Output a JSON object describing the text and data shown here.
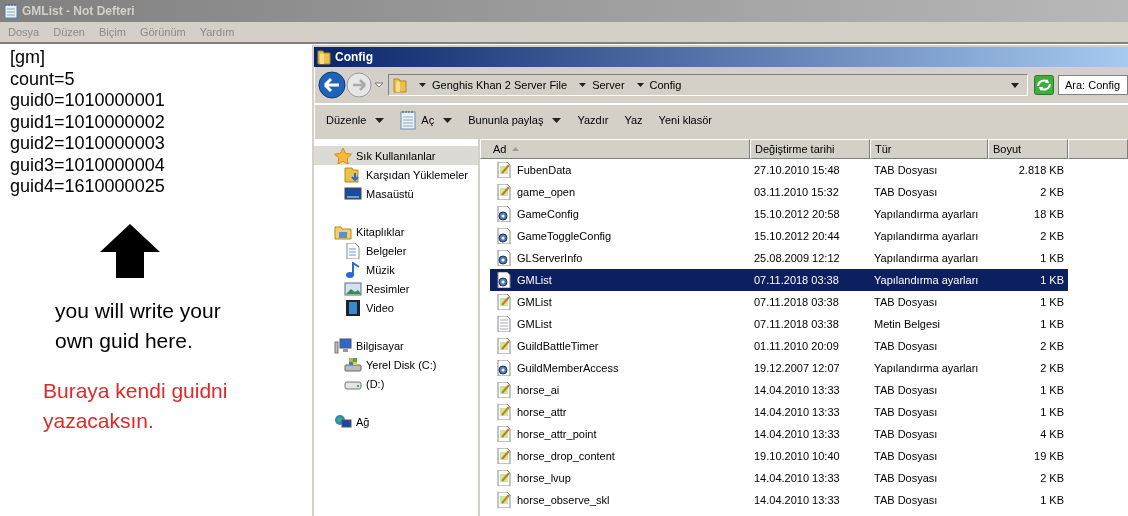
{
  "notepad": {
    "title": "GMList - Not Defteri",
    "menu": [
      "Dosya",
      "Düzen",
      "Biçim",
      "Görünüm",
      "Yardım"
    ],
    "lines": [
      "[gm]",
      "count=5",
      "guid0=1010000001",
      "guid1=1010000002",
      "guid2=1010000003",
      "guid3=1010000004",
      "guid4=1610000025"
    ],
    "note": "you will write your own guid here.",
    "note_tr": "Buraya kendi guidni yazacaksın."
  },
  "explorer": {
    "title": "Config",
    "breadcrumb": [
      "Genghis Khan 2 Server File",
      "Server",
      "Config"
    ],
    "search": {
      "placeholder": "Ara: Config"
    },
    "toolbar": [
      {
        "label": "Düzenle",
        "dropdown": true,
        "icon": false
      },
      {
        "label": "Aç",
        "dropdown": true,
        "icon": true
      },
      {
        "label": "Bununla paylaş",
        "dropdown": true,
        "icon": false
      },
      {
        "label": "Yazdır",
        "dropdown": false,
        "icon": false
      },
      {
        "label": "Yaz",
        "dropdown": false,
        "icon": false
      },
      {
        "label": "Yeni klasör",
        "dropdown": false,
        "icon": false
      }
    ],
    "nav": [
      {
        "label": "Sık Kullanılanlar",
        "kind": "star",
        "selected": true,
        "children": [
          {
            "label": "Karşıdan Yüklemeler",
            "kind": "download",
            "selected": false
          },
          {
            "label": "Masaüstü",
            "kind": "desktop",
            "selected": false
          }
        ]
      },
      {
        "label": "Kitaplıklar",
        "kind": "library",
        "selected": false,
        "children": [
          {
            "label": "Belgeler",
            "kind": "document",
            "selected": false
          },
          {
            "label": "Müzik",
            "kind": "music",
            "selected": false
          },
          {
            "label": "Resimler",
            "kind": "pictures",
            "selected": false
          },
          {
            "label": "Video",
            "kind": "video",
            "selected": false
          }
        ]
      },
      {
        "label": "Bilgisayar",
        "kind": "computer",
        "selected": false,
        "children": [
          {
            "label": "Yerel Disk (C:)",
            "kind": "disk",
            "selected": false
          },
          {
            "label": "(D:)",
            "kind": "drive",
            "selected": false
          }
        ]
      },
      {
        "label": "Ağ",
        "kind": "network",
        "selected": false
      }
    ],
    "columns": [
      {
        "label": "Ad",
        "sorted": true
      },
      {
        "label": "Değiştirme tarihi",
        "sorted": false
      },
      {
        "label": "Tür",
        "sorted": false
      },
      {
        "label": "Boyut",
        "sorted": false
      }
    ],
    "rows": [
      {
        "name": "FubenData",
        "date": "27.10.2010 15:48",
        "type": "TAB Dosyası",
        "size": "2.818 KB",
        "kind": "tab",
        "selected": false
      },
      {
        "name": "game_open",
        "date": "03.11.2010 15:32",
        "type": "TAB Dosyası",
        "size": "2 KB",
        "kind": "tab",
        "selected": false
      },
      {
        "name": "GameConfig",
        "date": "15.10.2012 20:58",
        "type": "Yapılandırma ayarları",
        "size": "18 KB",
        "kind": "config",
        "selected": false
      },
      {
        "name": "GameToggleConfig",
        "date": "15.10.2012 20:44",
        "type": "Yapılandırma ayarları",
        "size": "2 KB",
        "kind": "config",
        "selected": false
      },
      {
        "name": "GLServerInfo",
        "date": "25.08.2009 12:12",
        "type": "Yapılandırma ayarları",
        "size": "1 KB",
        "kind": "config",
        "selected": false
      },
      {
        "name": "GMList",
        "date": "07.11.2018 03:38",
        "type": "Yapılandırma ayarları",
        "size": "1 KB",
        "kind": "config",
        "selected": true
      },
      {
        "name": "GMList",
        "date": "07.11.2018 03:38",
        "type": "TAB Dosyası",
        "size": "1 KB",
        "kind": "tab",
        "selected": false
      },
      {
        "name": "GMList",
        "date": "07.11.2018 03:38",
        "type": "Metin Belgesi",
        "size": "1 KB",
        "kind": "text",
        "selected": false
      },
      {
        "name": "GuildBattleTimer",
        "date": "01.11.2010 20:09",
        "type": "TAB Dosyası",
        "size": "2 KB",
        "kind": "tab",
        "selected": false
      },
      {
        "name": "GuildMemberAccess",
        "date": "19.12.2007 12:07",
        "type": "Yapılandırma ayarları",
        "size": "2 KB",
        "kind": "config",
        "selected": false
      },
      {
        "name": "horse_ai",
        "date": "14.04.2010 13:33",
        "type": "TAB Dosyası",
        "size": "1 KB",
        "kind": "tab",
        "selected": false
      },
      {
        "name": "horse_attr",
        "date": "14.04.2010 13:33",
        "type": "TAB Dosyası",
        "size": "1 KB",
        "kind": "tab",
        "selected": false
      },
      {
        "name": "horse_attr_point",
        "date": "14.04.2010 13:33",
        "type": "TAB Dosyası",
        "size": "4 KB",
        "kind": "tab",
        "selected": false
      },
      {
        "name": "horse_drop_content",
        "date": "19.10.2010 10:40",
        "type": "TAB Dosyası",
        "size": "19 KB",
        "kind": "tab",
        "selected": false
      },
      {
        "name": "horse_lvup",
        "date": "14.04.2010 13:33",
        "type": "TAB Dosyası",
        "size": "2 KB",
        "kind": "tab",
        "selected": false
      },
      {
        "name": "horse_observe_skl",
        "date": "14.04.2010 13:33",
        "type": "TAB Dosyası",
        "size": "1 KB",
        "kind": "tab",
        "selected": false
      }
    ]
  }
}
